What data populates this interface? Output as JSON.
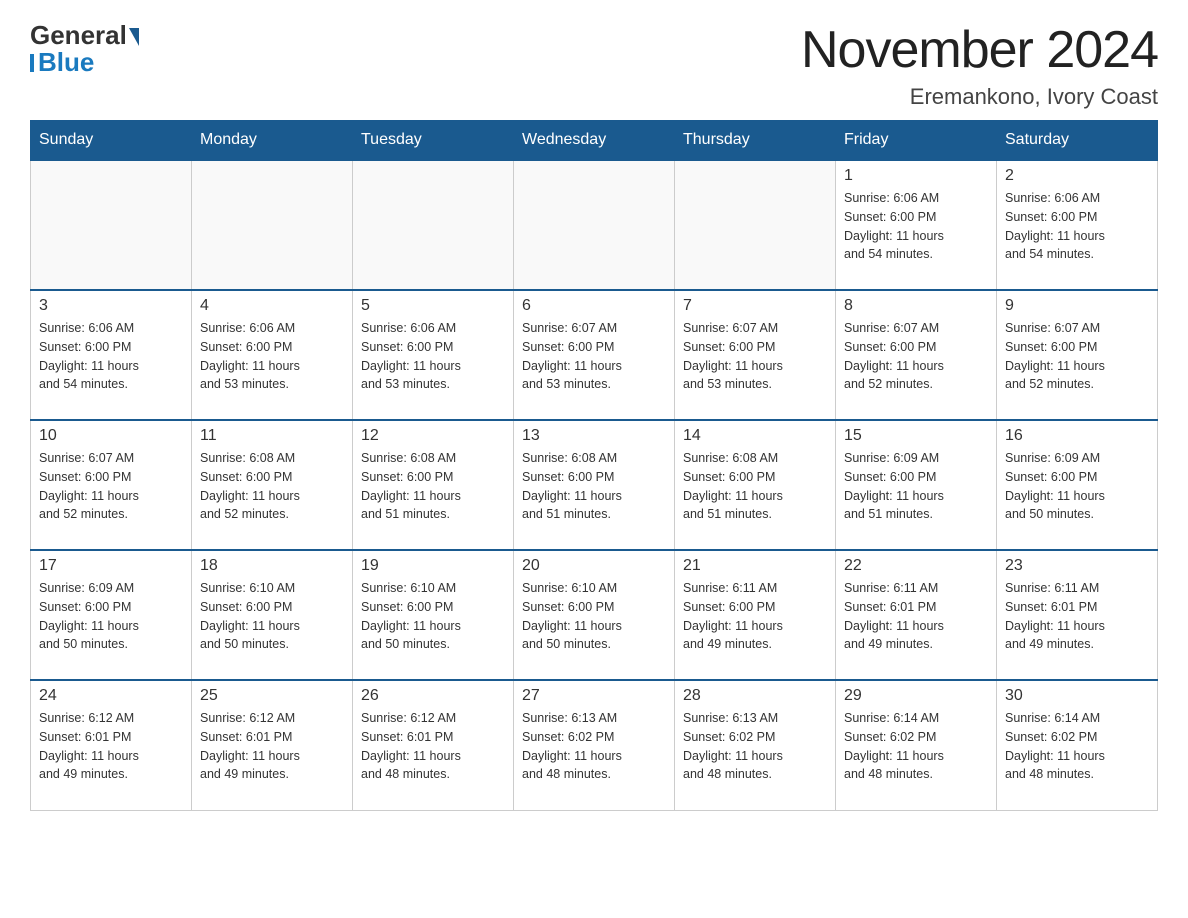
{
  "header": {
    "logo_general": "General",
    "logo_blue": "Blue",
    "title": "November 2024",
    "subtitle": "Eremankono, Ivory Coast"
  },
  "days_of_week": [
    "Sunday",
    "Monday",
    "Tuesday",
    "Wednesday",
    "Thursday",
    "Friday",
    "Saturday"
  ],
  "weeks": [
    [
      {
        "day": "",
        "info": ""
      },
      {
        "day": "",
        "info": ""
      },
      {
        "day": "",
        "info": ""
      },
      {
        "day": "",
        "info": ""
      },
      {
        "day": "",
        "info": ""
      },
      {
        "day": "1",
        "info": "Sunrise: 6:06 AM\nSunset: 6:00 PM\nDaylight: 11 hours\nand 54 minutes."
      },
      {
        "day": "2",
        "info": "Sunrise: 6:06 AM\nSunset: 6:00 PM\nDaylight: 11 hours\nand 54 minutes."
      }
    ],
    [
      {
        "day": "3",
        "info": "Sunrise: 6:06 AM\nSunset: 6:00 PM\nDaylight: 11 hours\nand 54 minutes."
      },
      {
        "day": "4",
        "info": "Sunrise: 6:06 AM\nSunset: 6:00 PM\nDaylight: 11 hours\nand 53 minutes."
      },
      {
        "day": "5",
        "info": "Sunrise: 6:06 AM\nSunset: 6:00 PM\nDaylight: 11 hours\nand 53 minutes."
      },
      {
        "day": "6",
        "info": "Sunrise: 6:07 AM\nSunset: 6:00 PM\nDaylight: 11 hours\nand 53 minutes."
      },
      {
        "day": "7",
        "info": "Sunrise: 6:07 AM\nSunset: 6:00 PM\nDaylight: 11 hours\nand 53 minutes."
      },
      {
        "day": "8",
        "info": "Sunrise: 6:07 AM\nSunset: 6:00 PM\nDaylight: 11 hours\nand 52 minutes."
      },
      {
        "day": "9",
        "info": "Sunrise: 6:07 AM\nSunset: 6:00 PM\nDaylight: 11 hours\nand 52 minutes."
      }
    ],
    [
      {
        "day": "10",
        "info": "Sunrise: 6:07 AM\nSunset: 6:00 PM\nDaylight: 11 hours\nand 52 minutes."
      },
      {
        "day": "11",
        "info": "Sunrise: 6:08 AM\nSunset: 6:00 PM\nDaylight: 11 hours\nand 52 minutes."
      },
      {
        "day": "12",
        "info": "Sunrise: 6:08 AM\nSunset: 6:00 PM\nDaylight: 11 hours\nand 51 minutes."
      },
      {
        "day": "13",
        "info": "Sunrise: 6:08 AM\nSunset: 6:00 PM\nDaylight: 11 hours\nand 51 minutes."
      },
      {
        "day": "14",
        "info": "Sunrise: 6:08 AM\nSunset: 6:00 PM\nDaylight: 11 hours\nand 51 minutes."
      },
      {
        "day": "15",
        "info": "Sunrise: 6:09 AM\nSunset: 6:00 PM\nDaylight: 11 hours\nand 51 minutes."
      },
      {
        "day": "16",
        "info": "Sunrise: 6:09 AM\nSunset: 6:00 PM\nDaylight: 11 hours\nand 50 minutes."
      }
    ],
    [
      {
        "day": "17",
        "info": "Sunrise: 6:09 AM\nSunset: 6:00 PM\nDaylight: 11 hours\nand 50 minutes."
      },
      {
        "day": "18",
        "info": "Sunrise: 6:10 AM\nSunset: 6:00 PM\nDaylight: 11 hours\nand 50 minutes."
      },
      {
        "day": "19",
        "info": "Sunrise: 6:10 AM\nSunset: 6:00 PM\nDaylight: 11 hours\nand 50 minutes."
      },
      {
        "day": "20",
        "info": "Sunrise: 6:10 AM\nSunset: 6:00 PM\nDaylight: 11 hours\nand 50 minutes."
      },
      {
        "day": "21",
        "info": "Sunrise: 6:11 AM\nSunset: 6:00 PM\nDaylight: 11 hours\nand 49 minutes."
      },
      {
        "day": "22",
        "info": "Sunrise: 6:11 AM\nSunset: 6:01 PM\nDaylight: 11 hours\nand 49 minutes."
      },
      {
        "day": "23",
        "info": "Sunrise: 6:11 AM\nSunset: 6:01 PM\nDaylight: 11 hours\nand 49 minutes."
      }
    ],
    [
      {
        "day": "24",
        "info": "Sunrise: 6:12 AM\nSunset: 6:01 PM\nDaylight: 11 hours\nand 49 minutes."
      },
      {
        "day": "25",
        "info": "Sunrise: 6:12 AM\nSunset: 6:01 PM\nDaylight: 11 hours\nand 49 minutes."
      },
      {
        "day": "26",
        "info": "Sunrise: 6:12 AM\nSunset: 6:01 PM\nDaylight: 11 hours\nand 48 minutes."
      },
      {
        "day": "27",
        "info": "Sunrise: 6:13 AM\nSunset: 6:02 PM\nDaylight: 11 hours\nand 48 minutes."
      },
      {
        "day": "28",
        "info": "Sunrise: 6:13 AM\nSunset: 6:02 PM\nDaylight: 11 hours\nand 48 minutes."
      },
      {
        "day": "29",
        "info": "Sunrise: 6:14 AM\nSunset: 6:02 PM\nDaylight: 11 hours\nand 48 minutes."
      },
      {
        "day": "30",
        "info": "Sunrise: 6:14 AM\nSunset: 6:02 PM\nDaylight: 11 hours\nand 48 minutes."
      }
    ]
  ]
}
